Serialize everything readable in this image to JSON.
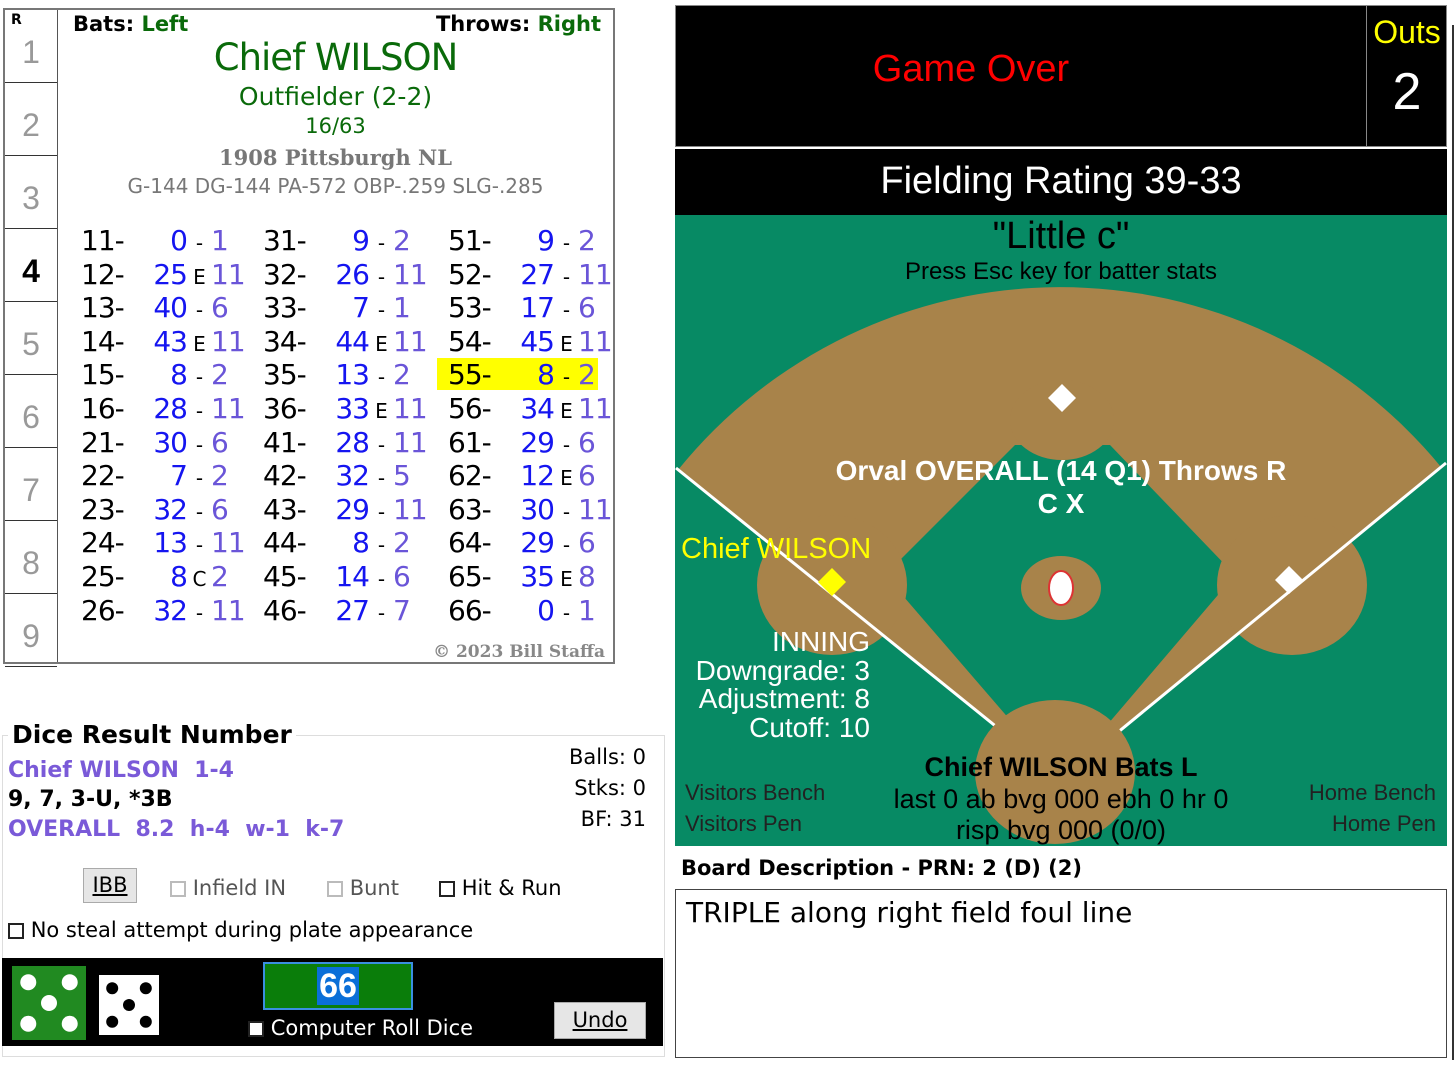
{
  "card": {
    "row_header": "R",
    "rows": [
      "1",
      "2",
      "3",
      "4",
      "5",
      "6",
      "7",
      "8",
      "9"
    ],
    "current_row": "4",
    "bats_label": "Bats:",
    "bats_value": "Left",
    "throws_label": "Throws:",
    "throws_value": "Right",
    "player_name": "Chief WILSON",
    "position": "Outfielder (2-2)",
    "ratio": "16/63",
    "team": "1908 Pittsburgh NL",
    "stats": "G-144 DG-144 PA-572 OBP-.259 SLG-.285",
    "copyright": "© 2023 Bill Staffa",
    "highlighted_roll": "55",
    "columns": [
      [
        [
          "11-",
          "0",
          "-",
          "1"
        ],
        [
          "12-",
          "25",
          "E",
          "11"
        ],
        [
          "13-",
          "40",
          "-",
          "6"
        ],
        [
          "14-",
          "43",
          "E",
          "11"
        ],
        [
          "15-",
          "8",
          "-",
          "2"
        ],
        [
          "16-",
          "28",
          "-",
          "11"
        ],
        [
          "21-",
          "30",
          "-",
          "6"
        ],
        [
          "22-",
          "7",
          "-",
          "2"
        ],
        [
          "23-",
          "32",
          "-",
          "6"
        ],
        [
          "24-",
          "13",
          "-",
          "11"
        ],
        [
          "25-",
          "8",
          "C",
          "2"
        ],
        [
          "26-",
          "32",
          "-",
          "11"
        ]
      ],
      [
        [
          "31-",
          "9",
          "-",
          "2"
        ],
        [
          "32-",
          "26",
          "-",
          "11"
        ],
        [
          "33-",
          "7",
          "-",
          "1"
        ],
        [
          "34-",
          "44",
          "E",
          "11"
        ],
        [
          "35-",
          "13",
          "-",
          "2"
        ],
        [
          "36-",
          "33",
          "E",
          "11"
        ],
        [
          "41-",
          "28",
          "-",
          "11"
        ],
        [
          "42-",
          "32",
          "-",
          "5"
        ],
        [
          "43-",
          "29",
          "-",
          "11"
        ],
        [
          "44-",
          "8",
          "-",
          "2"
        ],
        [
          "45-",
          "14",
          "-",
          "6"
        ],
        [
          "46-",
          "27",
          "-",
          "7"
        ]
      ],
      [
        [
          "51-",
          "9",
          "-",
          "2"
        ],
        [
          "52-",
          "27",
          "-",
          "11"
        ],
        [
          "53-",
          "17",
          "-",
          "6"
        ],
        [
          "54-",
          "45",
          "E",
          "11"
        ],
        [
          "55-",
          "8",
          "-",
          "2"
        ],
        [
          "56-",
          "34",
          "E",
          "11"
        ],
        [
          "61-",
          "29",
          "-",
          "6"
        ],
        [
          "62-",
          "12",
          "E",
          "6"
        ],
        [
          "63-",
          "30",
          "-",
          "11"
        ],
        [
          "64-",
          "29",
          "-",
          "6"
        ],
        [
          "65-",
          "35",
          "E",
          "8"
        ],
        [
          "66-",
          "0",
          "-",
          "1"
        ]
      ]
    ]
  },
  "dice": {
    "title": "Dice Result Number",
    "batter_line": "Chief WILSON  1-4",
    "result_line": "9, 7, 3-U, *3B",
    "pitcher_line": "OVERALL  8.2  h-4  w-1  k-7",
    "balls": "Balls: 0",
    "strikes": "Stks: 0",
    "bf": "BF: 31",
    "ibb": "IBB",
    "infield_in": "Infield IN",
    "bunt": "Bunt",
    "hit_run": "Hit & Run",
    "no_steal": "No steal attempt during plate appearance",
    "roll_value": "66",
    "computer_roll": "Computer Roll Dice",
    "undo": "Undo",
    "die1": 5,
    "die2": 5
  },
  "scoreboard": {
    "status": "Game Over",
    "outs_label": "Outs",
    "outs": "2",
    "fielding": "Fielding Rating 39-33"
  },
  "field": {
    "park": "\"Little c\"",
    "hint": "Press Esc key for batter stats",
    "pitcher": "Orval OVERALL (14 Q1) Throws R",
    "pitcher_sub": "C X",
    "runner_3b": "Chief WILSON",
    "inning": "INNING",
    "downgrade": "Downgrade: 3",
    "adjustment": "Adjustment: 8",
    "cutoff": "Cutoff: 10",
    "batter": "Chief WILSON Bats L",
    "batter_line1": "last 0 ab bvg 000 ebh 0 hr 0",
    "batter_line2": "risp bvg 000 (0/0)",
    "visitors_bench": "Visitors Bench",
    "visitors_pen": "Visitors Pen",
    "home_bench": "Home Bench",
    "home_pen": "Home Pen",
    "colors": {
      "grass": "#078a64",
      "dirt": "#a8834a",
      "runner": "#ffff00"
    }
  },
  "board": {
    "label": "Board Description - PRN: 2 (D) (2)",
    "text": "TRIPLE along right field foul line"
  }
}
